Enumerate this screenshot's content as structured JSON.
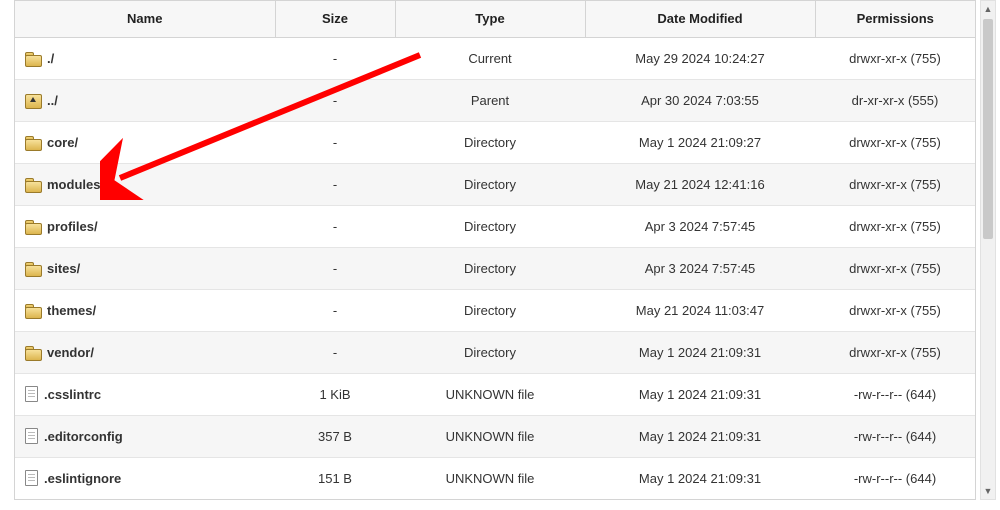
{
  "headers": {
    "name": "Name",
    "size": "Size",
    "type": "Type",
    "date": "Date Modified",
    "perm": "Permissions"
  },
  "rows": [
    {
      "icon": "folder",
      "name": "./",
      "size": "-",
      "type": "Current",
      "date": "May 29 2024 10:24:27",
      "perm": "drwxr-xr-x (755)"
    },
    {
      "icon": "folder-up",
      "name": "../",
      "size": "-",
      "type": "Parent",
      "date": "Apr 30 2024 7:03:55",
      "perm": "dr-xr-xr-x (555)"
    },
    {
      "icon": "folder",
      "name": "core/",
      "size": "-",
      "type": "Directory",
      "date": "May 1 2024 21:09:27",
      "perm": "drwxr-xr-x (755)"
    },
    {
      "icon": "folder",
      "name": "modules/",
      "size": "-",
      "type": "Directory",
      "date": "May 21 2024 12:41:16",
      "perm": "drwxr-xr-x (755)"
    },
    {
      "icon": "folder",
      "name": "profiles/",
      "size": "-",
      "type": "Directory",
      "date": "Apr 3 2024 7:57:45",
      "perm": "drwxr-xr-x (755)"
    },
    {
      "icon": "folder",
      "name": "sites/",
      "size": "-",
      "type": "Directory",
      "date": "Apr 3 2024 7:57:45",
      "perm": "drwxr-xr-x (755)"
    },
    {
      "icon": "folder",
      "name": "themes/",
      "size": "-",
      "type": "Directory",
      "date": "May 21 2024 11:03:47",
      "perm": "drwxr-xr-x (755)"
    },
    {
      "icon": "folder",
      "name": "vendor/",
      "size": "-",
      "type": "Directory",
      "date": "May 1 2024 21:09:31",
      "perm": "drwxr-xr-x (755)"
    },
    {
      "icon": "file",
      "name": ".csslintrc",
      "size": "1 KiB",
      "type": "UNKNOWN file",
      "date": "May 1 2024 21:09:31",
      "perm": "-rw-r--r-- (644)"
    },
    {
      "icon": "file",
      "name": ".editorconfig",
      "size": "357 B",
      "type": "UNKNOWN file",
      "date": "May 1 2024 21:09:31",
      "perm": "-rw-r--r-- (644)"
    },
    {
      "icon": "file",
      "name": ".eslintignore",
      "size": "151 B",
      "type": "UNKNOWN file",
      "date": "May 1 2024 21:09:31",
      "perm": "-rw-r--r-- (644)"
    }
  ],
  "annotation": {
    "arrow_color": "#ff0000"
  }
}
